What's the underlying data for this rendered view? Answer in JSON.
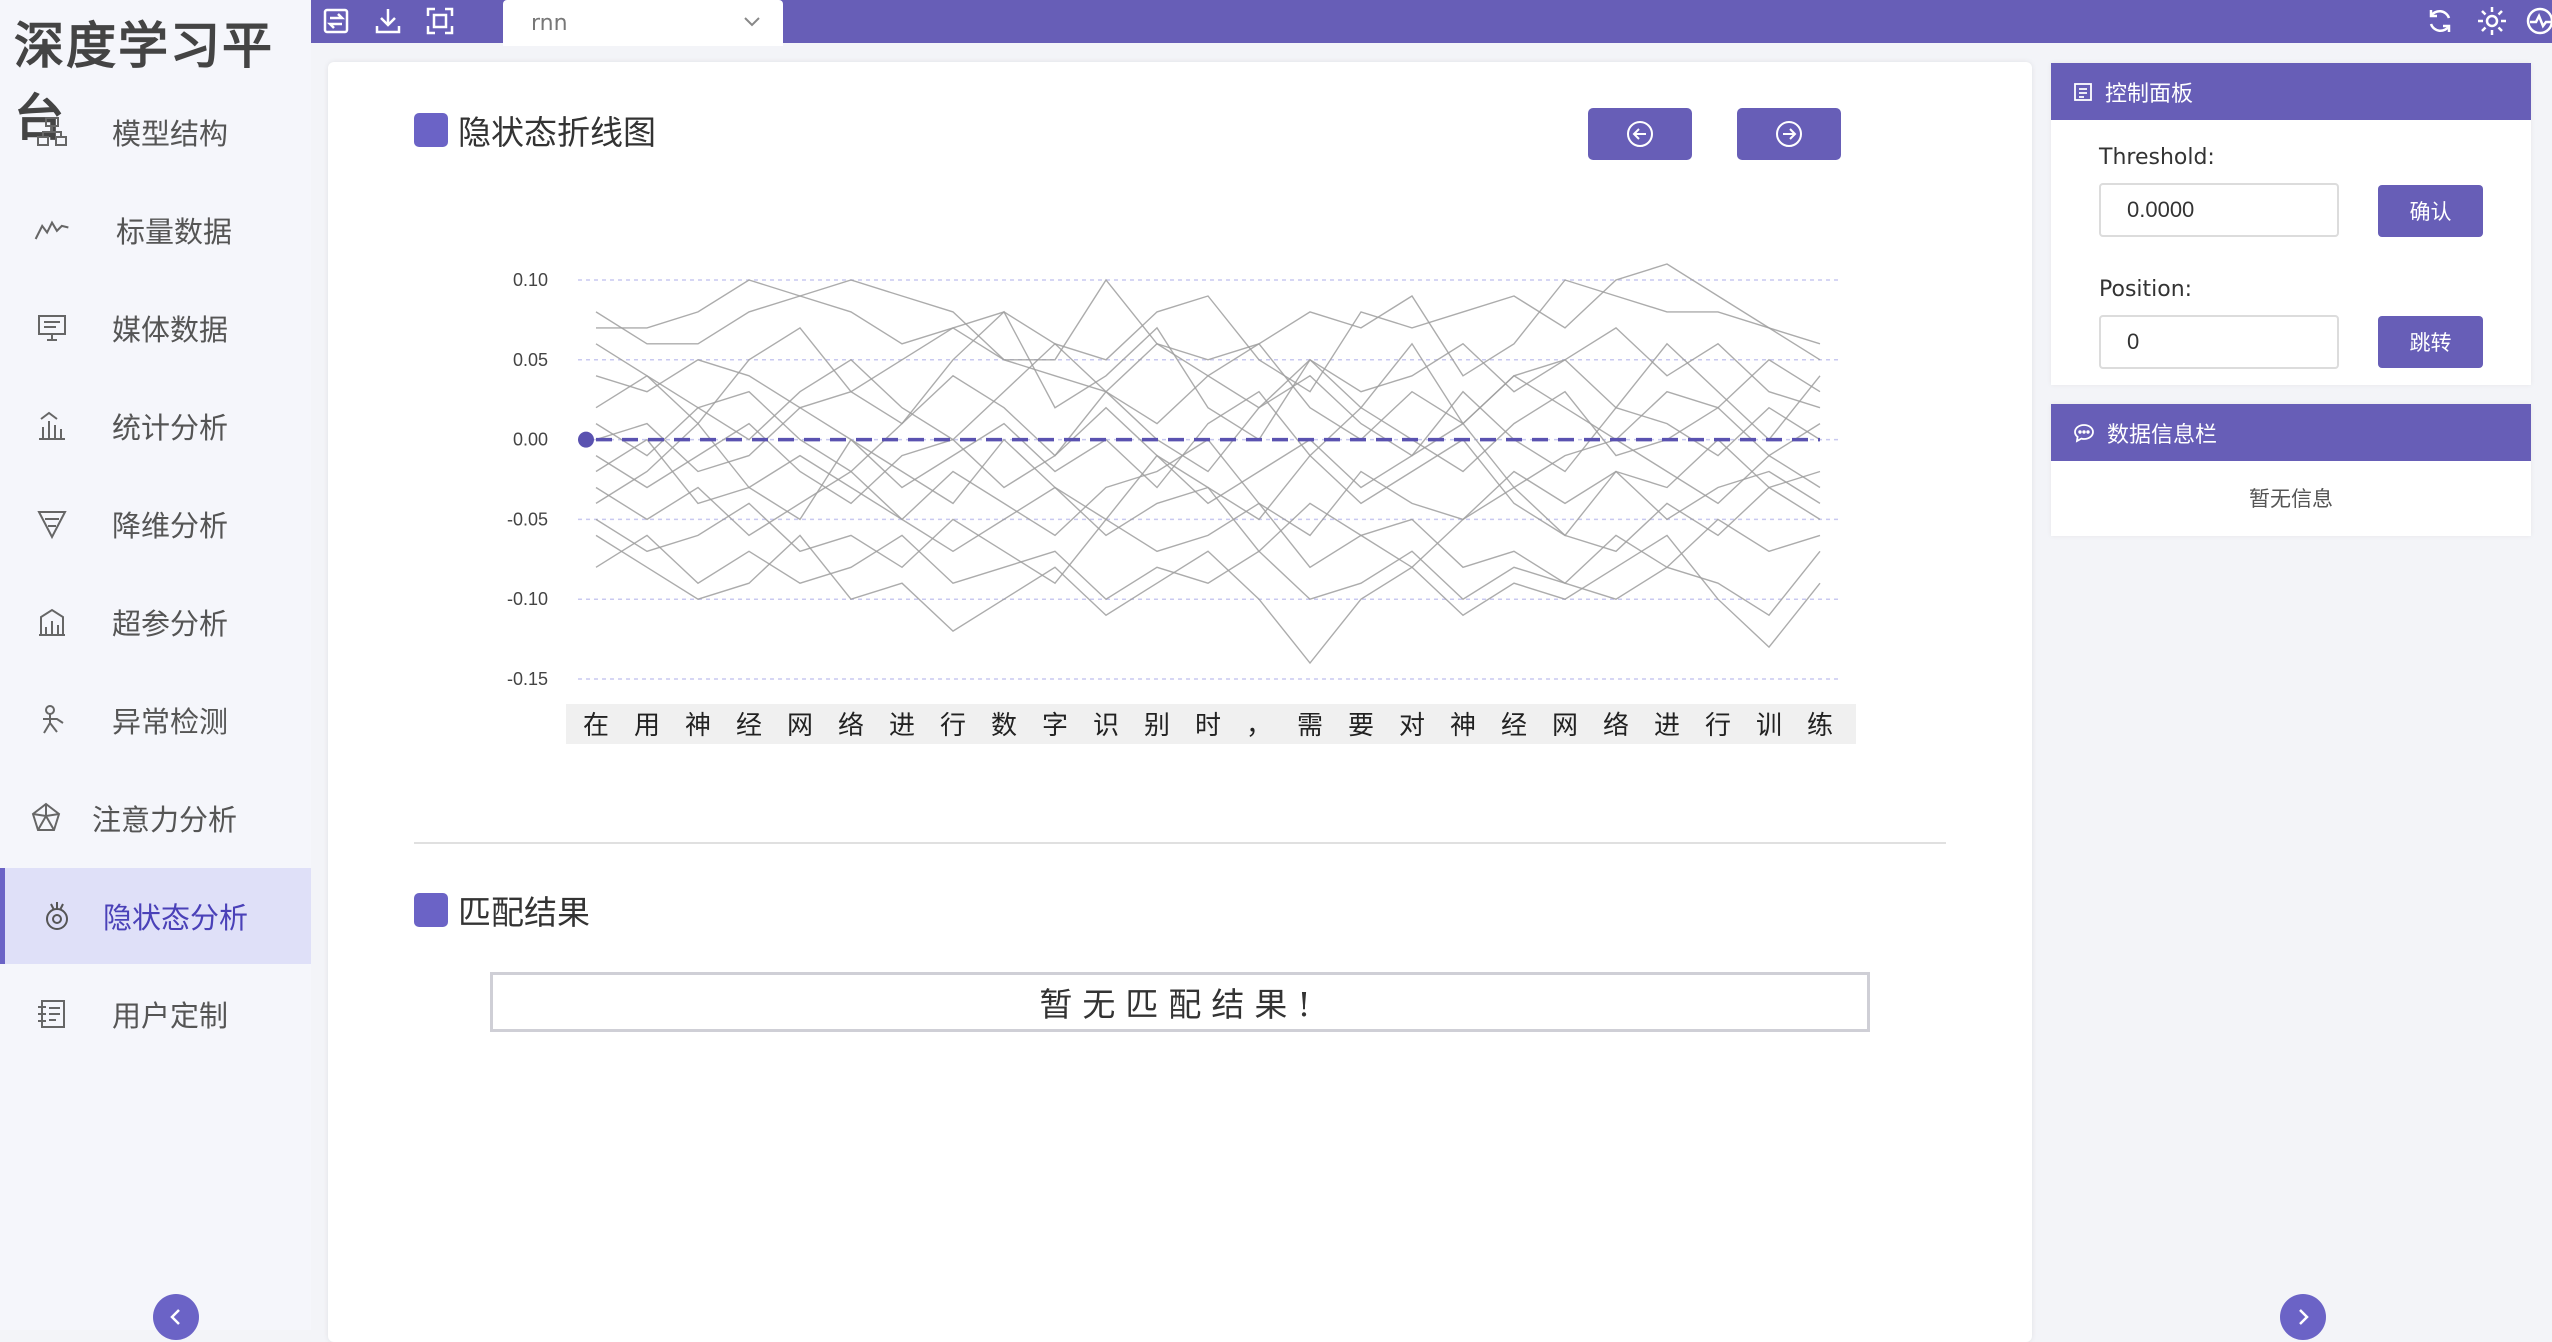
{
  "app_title": "深度学习平台",
  "sidebar": {
    "items": [
      {
        "label": "模型结构",
        "icon": "model-structure-icon"
      },
      {
        "label": "标量数据",
        "icon": "scalar-line-icon"
      },
      {
        "label": "媒体数据",
        "icon": "monitor-icon"
      },
      {
        "label": "统计分析",
        "icon": "histogram-icon"
      },
      {
        "label": "降维分析",
        "icon": "funnel-icon"
      },
      {
        "label": "超参分析",
        "icon": "building-chart-icon"
      },
      {
        "label": "异常检测",
        "icon": "person-detect-icon"
      },
      {
        "label": "注意力分析",
        "icon": "pentagon-icon"
      },
      {
        "label": "隐状态分析",
        "icon": "hidden-state-icon"
      },
      {
        "label": "用户定制",
        "icon": "custom-icon"
      }
    ],
    "active_index": 8
  },
  "topbar": {
    "model_select_value": "rnn"
  },
  "main": {
    "chart_section_title": "隐状态折线图",
    "match_section_title": "匹配结果",
    "match_empty_text": "暂无匹配结果!"
  },
  "right_panel": {
    "control_title": "控制面板",
    "threshold_label": "Threshold:",
    "threshold_value": "0.0000",
    "confirm_label": "确认",
    "position_label": "Position:",
    "position_value": "0",
    "jump_label": "跳转",
    "info_title": "数据信息栏",
    "info_empty": "暂无信息"
  },
  "colors": {
    "accent": "#675eb7",
    "active_bg": "#dfe0f8",
    "line": "#9e9e9e",
    "threshold": "#5a52b0"
  },
  "chart_data": {
    "type": "line",
    "categories": [
      "在",
      "用",
      "神",
      "经",
      "网",
      "络",
      "进",
      "行",
      "数",
      "字",
      "识",
      "别",
      "时",
      "，",
      "需",
      "要",
      "对",
      "神",
      "经",
      "网",
      "络",
      "进",
      "行",
      "训",
      "练"
    ],
    "ylim": [
      -0.15,
      0.1
    ],
    "yticks": [
      "0.10",
      "0.05",
      "0.00",
      "-0.05",
      "-0.10",
      "-0.15"
    ],
    "threshold": 0.0,
    "series": [
      {
        "values": [
          0.08,
          0.06,
          0.06,
          0.08,
          0.09,
          0.1,
          0.09,
          0.08,
          0.05,
          0.05,
          0.1,
          0.06,
          0.05,
          0.06,
          0.08,
          0.07,
          0.09,
          0.04,
          0.06,
          0.1,
          0.09,
          0.08,
          0.08,
          0.07,
          0.06
        ]
      },
      {
        "values": [
          0.07,
          0.07,
          0.08,
          0.1,
          0.09,
          0.08,
          0.06,
          0.07,
          0.08,
          0.06,
          0.05,
          0.08,
          0.09,
          0.05,
          0.03,
          0.08,
          0.07,
          0.08,
          0.09,
          0.07,
          0.1,
          0.11,
          0.09,
          0.07,
          0.05
        ]
      },
      {
        "values": [
          0.04,
          0.03,
          0.05,
          0.04,
          0.02,
          0.03,
          0.05,
          0.07,
          0.05,
          0.04,
          0.03,
          0.06,
          0.04,
          0.02,
          0.05,
          0.03,
          0.04,
          0.06,
          0.03,
          0.05,
          0.07,
          0.04,
          0.06,
          0.03,
          0.02
        ]
      },
      {
        "values": [
          0.02,
          0.04,
          0.02,
          0.0,
          0.03,
          0.05,
          0.02,
          0.0,
          0.03,
          0.06,
          0.03,
          0.01,
          0.04,
          0.06,
          0.02,
          0.0,
          0.03,
          0.01,
          0.04,
          0.02,
          0.0,
          0.03,
          0.02,
          0.05,
          0.03
        ]
      },
      {
        "values": [
          0.01,
          -0.01,
          0.02,
          0.03,
          0.0,
          -0.02,
          0.01,
          0.04,
          0.02,
          -0.01,
          0.03,
          0.0,
          -0.02,
          0.02,
          0.04,
          0.01,
          -0.01,
          0.03,
          0.0,
          -0.02,
          0.02,
          0.01,
          -0.01,
          0.02,
          0.0
        ]
      },
      {
        "values": [
          0.0,
          0.01,
          -0.02,
          -0.01,
          0.02,
          0.0,
          -0.03,
          -0.01,
          0.01,
          -0.02,
          0.0,
          -0.03,
          0.01,
          0.03,
          -0.01,
          0.02,
          0.0,
          -0.02,
          0.01,
          0.03,
          -0.01,
          0.0,
          0.02,
          -0.01,
          0.01
        ]
      },
      {
        "values": [
          -0.01,
          -0.03,
          -0.01,
          0.01,
          -0.02,
          -0.04,
          -0.01,
          0.0,
          -0.03,
          -0.01,
          0.02,
          -0.01,
          -0.04,
          -0.02,
          0.0,
          -0.03,
          -0.01,
          0.01,
          -0.03,
          -0.01,
          0.0,
          -0.02,
          -0.04,
          -0.01,
          -0.03
        ]
      },
      {
        "values": [
          -0.02,
          0.0,
          -0.04,
          -0.03,
          -0.01,
          -0.03,
          -0.05,
          -0.02,
          -0.04,
          -0.06,
          -0.03,
          -0.02,
          0.0,
          -0.04,
          -0.06,
          -0.02,
          -0.04,
          -0.05,
          -0.02,
          -0.04,
          -0.02,
          -0.05,
          -0.03,
          -0.02,
          -0.04
        ]
      },
      {
        "values": [
          -0.03,
          -0.05,
          -0.03,
          -0.06,
          -0.04,
          -0.02,
          -0.05,
          -0.07,
          -0.05,
          -0.03,
          -0.06,
          -0.04,
          -0.03,
          -0.07,
          -0.04,
          -0.06,
          -0.08,
          -0.05,
          -0.03,
          -0.06,
          -0.07,
          -0.04,
          -0.06,
          -0.03,
          -0.05
        ]
      },
      {
        "values": [
          -0.05,
          -0.07,
          -0.06,
          -0.04,
          -0.07,
          -0.06,
          -0.08,
          -0.05,
          -0.07,
          -0.09,
          -0.05,
          -0.07,
          -0.06,
          -0.04,
          -0.08,
          -0.06,
          -0.05,
          -0.08,
          -0.07,
          -0.09,
          -0.06,
          -0.08,
          -0.05,
          -0.07,
          -0.06
        ]
      },
      {
        "values": [
          -0.08,
          -0.06,
          -0.09,
          -0.07,
          -0.09,
          -0.08,
          -0.06,
          -0.09,
          -0.08,
          -0.07,
          -0.1,
          -0.08,
          -0.09,
          -0.07,
          -0.1,
          -0.09,
          -0.07,
          -0.1,
          -0.08,
          -0.09,
          -0.1,
          -0.08,
          -0.09,
          -0.11,
          -0.07
        ]
      },
      {
        "values": [
          -0.06,
          -0.08,
          -0.1,
          -0.09,
          -0.06,
          -0.1,
          -0.09,
          -0.12,
          -0.1,
          -0.08,
          -0.11,
          -0.09,
          -0.07,
          -0.1,
          -0.14,
          -0.1,
          -0.08,
          -0.11,
          -0.09,
          -0.1,
          -0.08,
          -0.06,
          -0.1,
          -0.13,
          -0.09
        ]
      },
      {
        "values": [
          0.06,
          0.04,
          0.01,
          0.05,
          0.07,
          0.03,
          0.01,
          0.05,
          0.08,
          0.02,
          0.04,
          0.07,
          0.02,
          0.0,
          0.05,
          0.02,
          0.06,
          0.01,
          0.04,
          0.05,
          0.02,
          0.06,
          0.03,
          0.0,
          0.04
        ]
      },
      {
        "values": [
          -0.04,
          -0.02,
          0.01,
          -0.03,
          -0.05,
          0.0,
          -0.02,
          -0.04,
          0.0,
          -0.03,
          -0.05,
          -0.01,
          -0.03,
          -0.05,
          -0.01,
          -0.04,
          -0.02,
          0.0,
          -0.04,
          -0.06,
          -0.02,
          -0.03,
          0.0,
          -0.03,
          -0.02
        ]
      }
    ]
  }
}
